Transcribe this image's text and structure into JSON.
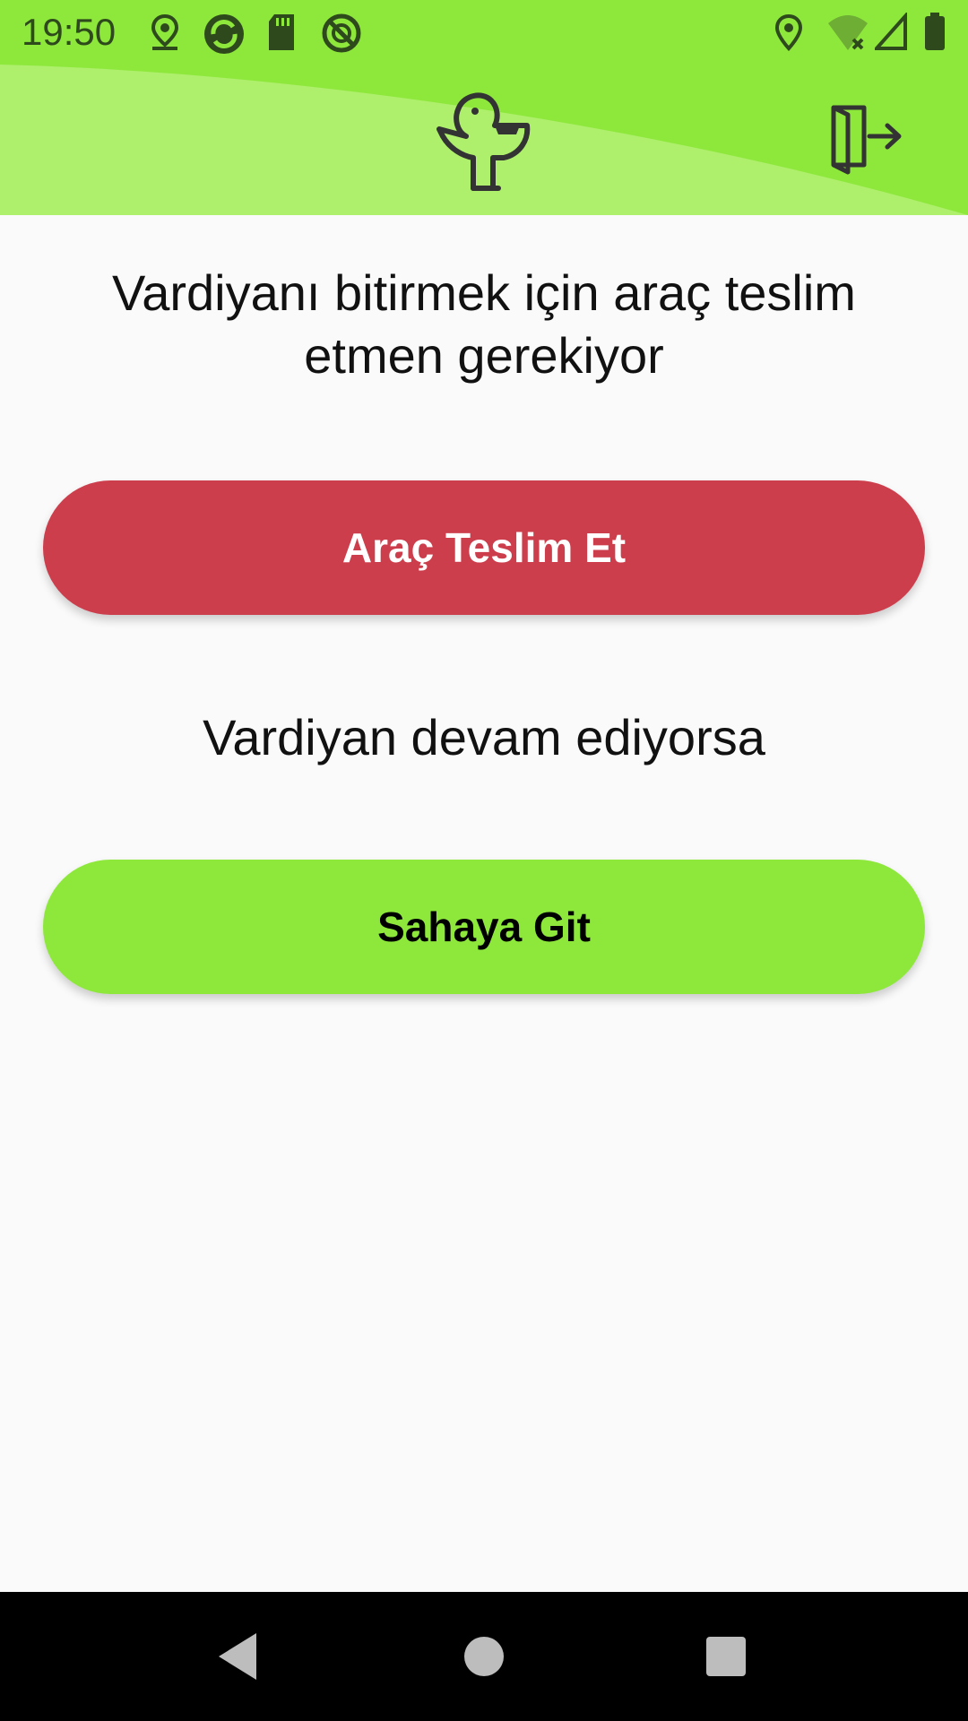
{
  "status_bar": {
    "time": "19:50",
    "icons": [
      "location-pin-icon",
      "sync-app-icon",
      "sd-card-icon",
      "no-disturb-icon",
      "gps-icon",
      "wifi-off-icon",
      "signal-icon",
      "battery-icon"
    ]
  },
  "header": {
    "logo_icon": "duck-logo-icon",
    "logout_icon": "logout-icon",
    "accent_color": "#8ee83c"
  },
  "main": {
    "message": "Vardiyanı bitirmek için araç teslim etmen gerekiyor",
    "deliver_button_label": "Araç Teslim Et",
    "deliver_button_color": "#cd3e4d",
    "secondary_message": "Vardiyan devam ediyorsa",
    "field_button_label": "Sahaya Git",
    "field_button_color": "#8ee83c"
  },
  "nav_bar": {
    "icons": [
      "back-icon",
      "home-icon",
      "recents-icon"
    ]
  }
}
